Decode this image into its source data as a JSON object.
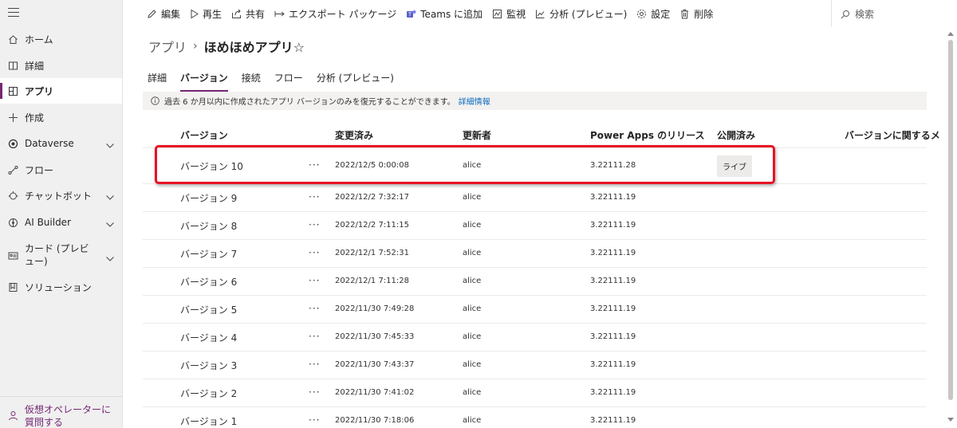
{
  "sidebar": {
    "items": [
      {
        "label": "ホーム",
        "icon": "home-icon"
      },
      {
        "label": "詳細",
        "icon": "book-icon"
      },
      {
        "label": "アプリ",
        "icon": "apps-icon",
        "active": true
      },
      {
        "label": "作成",
        "icon": "plus-icon"
      },
      {
        "label": "Dataverse",
        "icon": "dataverse-icon",
        "expandable": true
      },
      {
        "label": "フロー",
        "icon": "flow-icon"
      },
      {
        "label": "チャットボット",
        "icon": "chatbot-icon",
        "expandable": true
      },
      {
        "label": "AI Builder",
        "icon": "ai-builder-icon",
        "expandable": true
      },
      {
        "label": "カード (プレビュー)",
        "icon": "cards-icon",
        "expandable": true
      },
      {
        "label": "ソリューション",
        "icon": "solutions-icon"
      }
    ],
    "footer": {
      "label": "仮想オペレーターに質問する",
      "icon": "virtual-agent-icon"
    }
  },
  "commandbar": {
    "edit": "編集",
    "play": "再生",
    "share": "共有",
    "export": "エクスポート パッケージ",
    "teams": "Teams に追加",
    "monitor": "監視",
    "analytics": "分析 (プレビュー)",
    "settings": "設定",
    "delete": "削除",
    "search": "検索"
  },
  "breadcrumb": {
    "root": "アプリ",
    "separator": "›",
    "current": "ほめほめアプリ☆"
  },
  "tabs": [
    "詳細",
    "バージョン",
    "接続",
    "フロー",
    "分析 (プレビュー)"
  ],
  "active_tab": "バージョン",
  "info": {
    "text": "過去 6 か月以内に作成されたアプリ バージョンのみを復元することができます。",
    "link": "詳細情報"
  },
  "table": {
    "headers": {
      "version": "バージョン",
      "modified": "変更済み",
      "modified_by": "更新者",
      "powerapps_release": "Power Apps のリリース",
      "published": "公開済み",
      "notes": "バージョンに関するメ"
    },
    "more_label": "···",
    "rows": [
      {
        "version": "バージョン 10",
        "modified": "2022/12/5 0:00:08",
        "by": "alice",
        "release": "3.22111.28",
        "published": "ライブ"
      },
      {
        "version": "バージョン 9",
        "modified": "2022/12/2 7:32:17",
        "by": "alice",
        "release": "3.22111.19",
        "published": ""
      },
      {
        "version": "バージョン 8",
        "modified": "2022/12/2 7:11:15",
        "by": "alice",
        "release": "3.22111.19",
        "published": ""
      },
      {
        "version": "バージョン 7",
        "modified": "2022/12/1 7:52:31",
        "by": "alice",
        "release": "3.22111.19",
        "published": ""
      },
      {
        "version": "バージョン 6",
        "modified": "2022/12/1 7:11:28",
        "by": "alice",
        "release": "3.22111.19",
        "published": ""
      },
      {
        "version": "バージョン 5",
        "modified": "2022/11/30 7:49:28",
        "by": "alice",
        "release": "3.22111.19",
        "published": ""
      },
      {
        "version": "バージョン 4",
        "modified": "2022/11/30 7:45:33",
        "by": "alice",
        "release": "3.22111.19",
        "published": ""
      },
      {
        "version": "バージョン 3",
        "modified": "2022/11/30 7:43:37",
        "by": "alice",
        "release": "3.22111.19",
        "published": ""
      },
      {
        "version": "バージョン 2",
        "modified": "2022/11/30 7:41:02",
        "by": "alice",
        "release": "3.22111.19",
        "published": ""
      },
      {
        "version": "バージョン 1",
        "modified": "2022/11/30 7:18:06",
        "by": "alice",
        "release": "3.22111.19",
        "published": ""
      }
    ]
  },
  "colors": {
    "accent": "#742774",
    "highlight": "#e81123",
    "link": "#0f6cbd"
  }
}
